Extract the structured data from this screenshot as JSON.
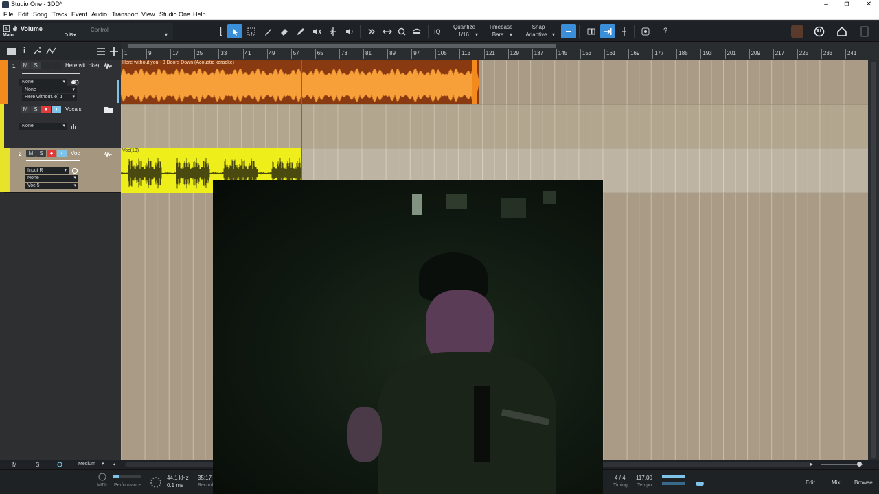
{
  "window": {
    "title": "Studio One - 3DD*",
    "minimize": "–",
    "restore": "❐",
    "close": "✕"
  },
  "menu": [
    "File",
    "Edit",
    "Song",
    "Track",
    "Event",
    "Audio",
    "Transport",
    "View",
    "Studio One",
    "Help"
  ],
  "toolbar": {
    "volume_label": "Volume",
    "volume_target": "Main",
    "volume_value": "0dB",
    "control_label": "Control",
    "quantize_label": "Quantize",
    "quantize_value": "1/16",
    "timebase_label": "Timebase",
    "timebase_value": "Bars",
    "snap_label": "Snap",
    "snap_value": "Adaptive",
    "iq_label": "IQ",
    "help_label": "?"
  },
  "ruler": {
    "labels": [
      "1",
      "9",
      "17",
      "25",
      "33",
      "41",
      "49",
      "57",
      "65",
      "73",
      "81",
      "89",
      "97",
      "105",
      "113",
      "121",
      "129",
      "137",
      "145",
      "153",
      "161",
      "169",
      "177",
      "185",
      "193",
      "201",
      "209",
      "217",
      "225",
      "233",
      "241"
    ]
  },
  "tracks": [
    {
      "number": "1",
      "name": "Here wit..oke)",
      "field1": "None",
      "field2": "None",
      "field3": "Here without..e) 1",
      "event_name": "Here without you - 3 Doors Down (Acoustic karaoke)",
      "color": "#f28a1e"
    },
    {
      "number": "",
      "name": "Vocals",
      "field1": "None",
      "color": "#e6e32a"
    },
    {
      "number": "2",
      "name": "Voc",
      "field1": "Input R",
      "field2": "None",
      "field3": "Voc 5",
      "event_name": "Voc(19)",
      "color": "#f0ee1e"
    }
  ],
  "buttons": {
    "mute": "M",
    "solo": "S",
    "footer_m": "M",
    "footer_s": "S",
    "footer_size": "Medium"
  },
  "status": {
    "midi": "MIDI",
    "performance": "Performance",
    "sample_rate": "44.1 kHz",
    "latency": "0.1 ms",
    "record_time": "35:17",
    "record_label": "Record",
    "timing_value": "4 / 4",
    "timing_label": "Timing",
    "tempo_value": "117.00",
    "tempo_label": "Tempo",
    "edit": "Edit",
    "mix": "Mix",
    "browse": "Browse"
  },
  "colors": {
    "accent": "#3a8fd8",
    "record": "#e03a3a",
    "arrange_bg": "#a99b85"
  }
}
